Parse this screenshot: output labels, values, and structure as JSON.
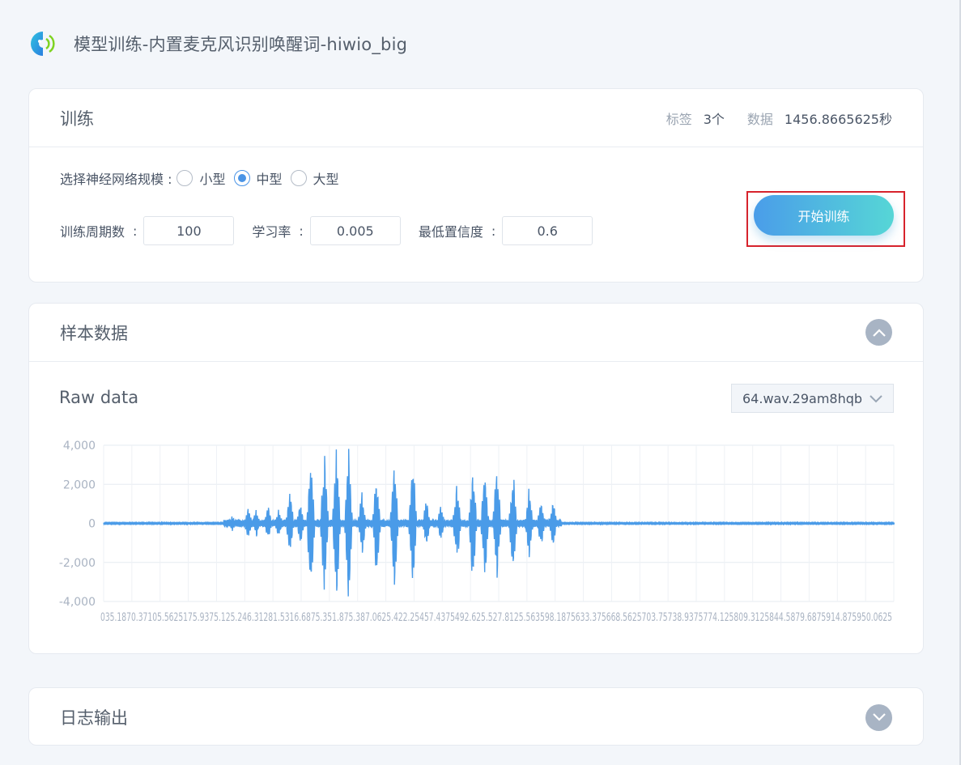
{
  "header": {
    "title": "模型训练-内置麦克风识别唤醒词-hiwio_big"
  },
  "training": {
    "title": "训练",
    "labels_label": "标签",
    "labels_value": "3个",
    "data_label": "数据",
    "data_value": "1456.8665625秒",
    "network_label": "选择神经网络规模 :",
    "options": [
      "小型",
      "中型",
      "大型"
    ],
    "selected": "中型",
    "epochs_label": "训练周期数",
    "epochs_value": "100",
    "lr_label": "学习率",
    "lr_value": "0.005",
    "conf_label": "最低置信度",
    "conf_value": "0.6",
    "colon": ":",
    "start_label": "开始训练"
  },
  "samples": {
    "title": "样本数据",
    "raw_title": "Raw data",
    "file_selected": "64.wav.29am8hqb"
  },
  "log": {
    "title": "日志输出"
  },
  "chart_data": {
    "type": "line",
    "series_color": "#4a9be8",
    "y_ticks": [
      "4,000",
      "2,000",
      "0",
      "-2,000",
      "-4,000"
    ],
    "ylim": [
      -4000,
      4000
    ],
    "x_tick_labels_overlapping": "0 35.1875 70.375 105.5625 140.75 175.9375 211.125 246.3125 281.5 316.6875 351.875 387.0625 422.25 457.4375 492.625 527.8125 563 598.1875 633.375 668.5625 703.75 738.9375 774.125 809.3125 844.5 879.6875 914.875 950.0625",
    "x_label_text_as_shown": "035.1870.37105.5625175.9375.125.246.31281.5316.6875.351.875.387.0625.422.25457.4375492.625.527.8125.563598.1875633.375668.5625703.75738.9375774.125809.3125844.5879.6875914.875950.0625",
    "grid": true,
    "x_range": [
      0,
      985
    ],
    "bursts": [
      {
        "x": 160,
        "amp": 400
      },
      {
        "x": 180,
        "amp": 800
      },
      {
        "x": 190,
        "amp": 700
      },
      {
        "x": 205,
        "amp": 900
      },
      {
        "x": 218,
        "amp": 700
      },
      {
        "x": 232,
        "amp": 1600
      },
      {
        "x": 245,
        "amp": 1100
      },
      {
        "x": 258,
        "amp": 3900
      },
      {
        "x": 275,
        "amp": 3600
      },
      {
        "x": 290,
        "amp": 4000
      },
      {
        "x": 305,
        "amp": 3900
      },
      {
        "x": 322,
        "amp": 1700
      },
      {
        "x": 340,
        "amp": 2700
      },
      {
        "x": 362,
        "amp": 3300
      },
      {
        "x": 385,
        "amp": 3700
      },
      {
        "x": 402,
        "amp": 1300
      },
      {
        "x": 420,
        "amp": 900
      },
      {
        "x": 440,
        "amp": 2200
      },
      {
        "x": 460,
        "amp": 3200
      },
      {
        "x": 475,
        "amp": 3000
      },
      {
        "x": 490,
        "amp": 3100
      },
      {
        "x": 510,
        "amp": 2800
      },
      {
        "x": 530,
        "amp": 1800
      },
      {
        "x": 545,
        "amp": 1300
      },
      {
        "x": 560,
        "amp": 1200
      }
    ]
  }
}
